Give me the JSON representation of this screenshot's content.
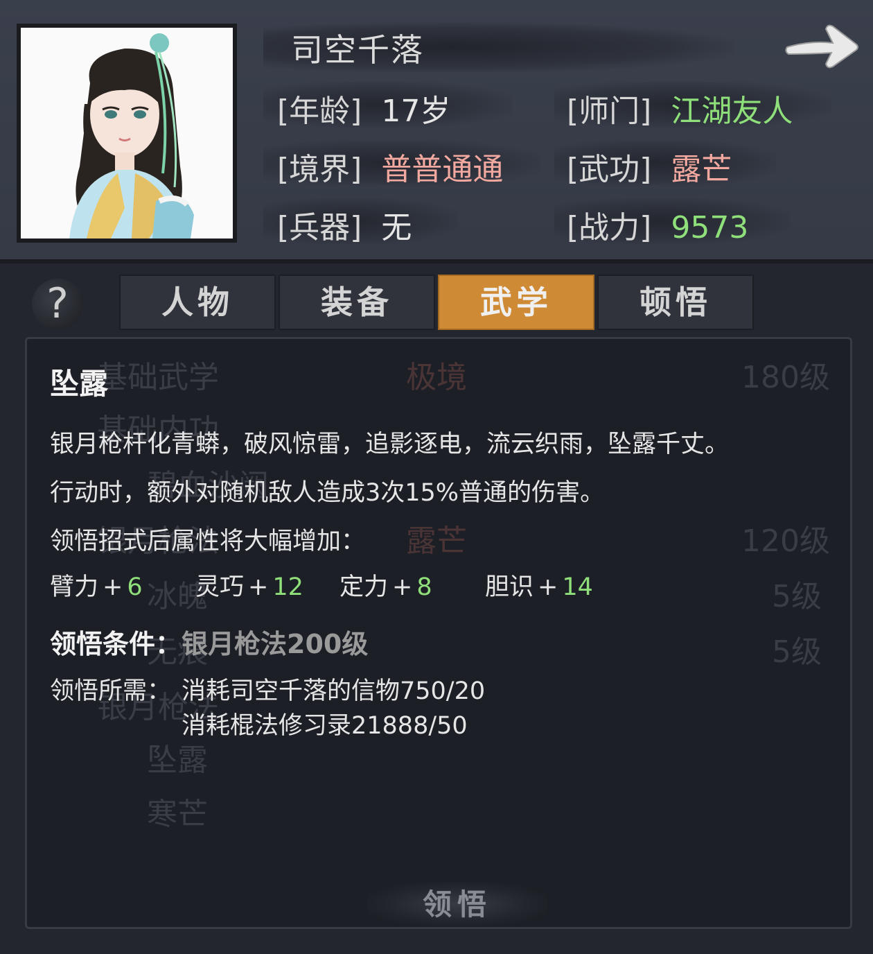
{
  "character": {
    "name": "司空千落",
    "stats": {
      "age_label": "[年龄]",
      "age_value": "17岁",
      "sect_label": "[师门]",
      "sect_value": "江湖友人",
      "realm_label": "[境界]",
      "realm_value": "普普通通",
      "martial_label": "[武功]",
      "martial_value": "露芒",
      "weapon_label": "[兵器]",
      "weapon_value": "无",
      "power_label": "[战力]",
      "power_value": "9573"
    }
  },
  "help_icon": "?",
  "tabs": [
    {
      "label": "人物",
      "active": false
    },
    {
      "label": "装备",
      "active": false
    },
    {
      "label": "武学",
      "active": true
    },
    {
      "label": "顿悟",
      "active": false
    }
  ],
  "background_list": {
    "header": {
      "left": "基础武学",
      "middle": "极境",
      "right": "180级"
    },
    "rows": [
      {
        "left": "基础内功"
      },
      {
        "left": "碧血沙阙"
      },
      {
        "left": "银月枪法",
        "middle": "露芒",
        "right": "120级"
      },
      {
        "left": "冰魄",
        "right": "5级"
      },
      {
        "left": "无痕",
        "right": "5级"
      },
      {
        "left": "银月枪法"
      },
      {
        "left": "坠露"
      },
      {
        "left": "寒芒"
      }
    ]
  },
  "detail": {
    "title": "坠露",
    "desc1": "银月枪杆化青蟒，破风惊雷，追影逐电，流云织雨，坠露千丈。",
    "desc2": "行动时，额外对随机敌人造成3次15%普通的伤害。",
    "desc3": "领悟招式后属性将大幅增加：",
    "attributes": [
      {
        "name": "臂力",
        "plus": "+",
        "value": "6"
      },
      {
        "name": "灵巧",
        "plus": "+",
        "value": "12"
      },
      {
        "name": "定力",
        "plus": "+",
        "value": "8"
      },
      {
        "name": "胆识",
        "plus": "+",
        "value": "14"
      }
    ],
    "condition_label": "领悟条件：",
    "condition_value": "银月枪法200级",
    "requirement_label": "领悟所需：",
    "requirements": [
      "消耗司空千落的信物750/20",
      "消耗棍法修习录21888/50"
    ]
  },
  "comprehend_button": "领悟",
  "colors": {
    "accent": "#cf8a35",
    "green": "#8fe07a",
    "pink": "#f3a9a0"
  }
}
